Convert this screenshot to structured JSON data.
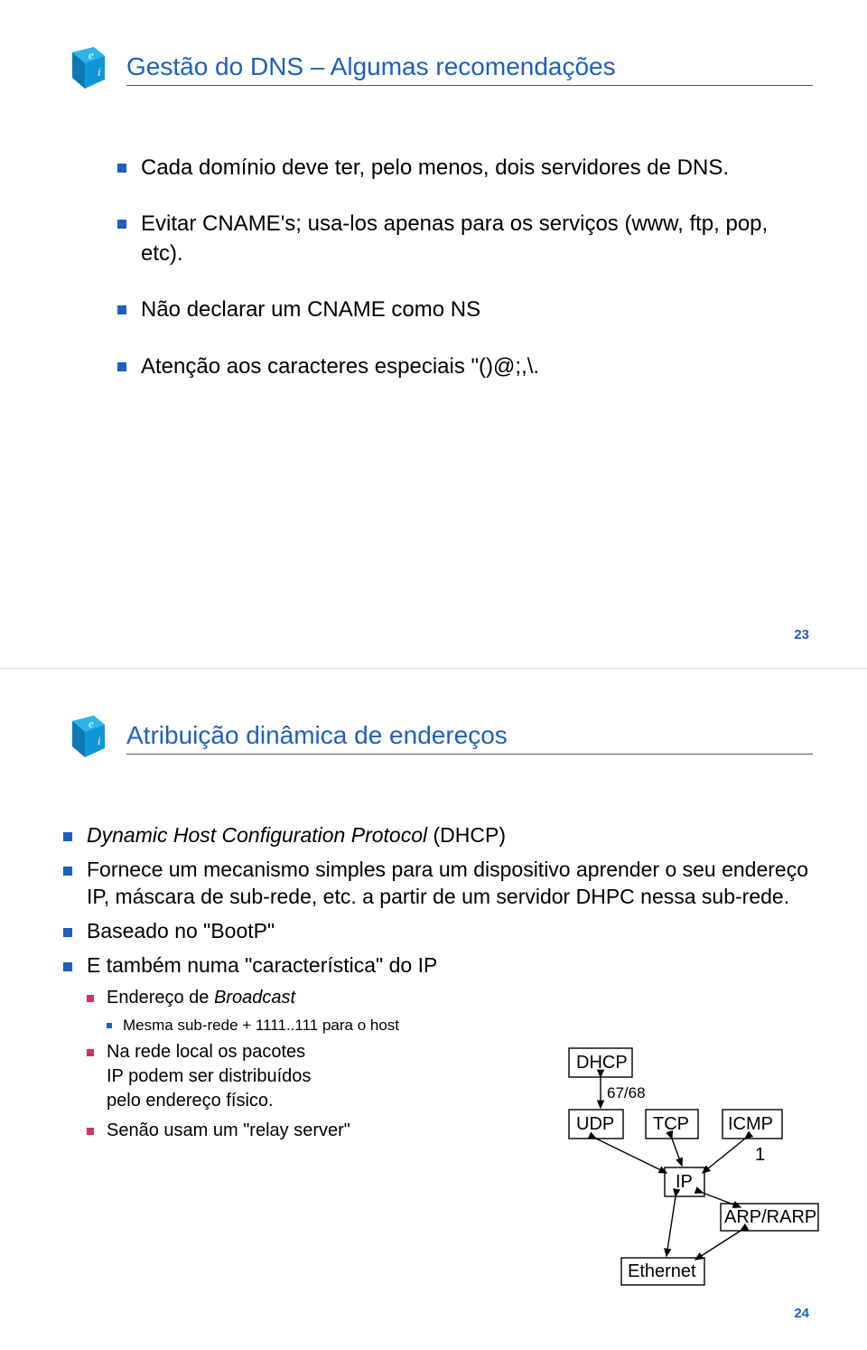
{
  "slides": [
    {
      "title": "Gestão do DNS – Algumas recomendações",
      "bullets": [
        "Cada domínio deve ter, pelo menos, dois servidores de DNS.",
        "Evitar CNAME's; usa-los apenas para os serviços (www, ftp, pop, etc).",
        "Não declarar um CNAME como NS",
        "Atenção aos caracteres especiais \"()@;,\\."
      ],
      "page": "23"
    },
    {
      "title": "Atribuição dinâmica de endereços",
      "b1": {
        "italic_lead": "Dynamic Host Configuration Protocol",
        "rest": " (DHCP)"
      },
      "b2": "Fornece um mecanismo simples para um dispositivo aprender o seu endereço IP, máscara de sub-rede, etc. a partir de um servidor DHPC nessa sub-rede.",
      "b3": "Baseado no \"BootP\"",
      "b4": "E também numa \"característica\" do IP",
      "b4_sub1": {
        "lead": "Endereço de ",
        "italic": "Broadcast"
      },
      "b4_sub1_sub": "Mesma sub-rede + 1111..111 para o host",
      "b4_sub2_l1": "Na rede local os pacotes",
      "b4_sub2_l2": "IP podem ser distribuídos",
      "b4_sub2_l3": "pelo endereço físico.",
      "b4_sub3": "Senão usam um \"relay server\"",
      "page": "24",
      "diagram": {
        "dhcp": "DHCP",
        "port": "67/68",
        "udp": "UDP",
        "tcp": "TCP",
        "icmp": "ICMP",
        "one": "1",
        "ip": "IP",
        "arp": "ARP/RARP",
        "eth": "Ethernet"
      }
    }
  ]
}
